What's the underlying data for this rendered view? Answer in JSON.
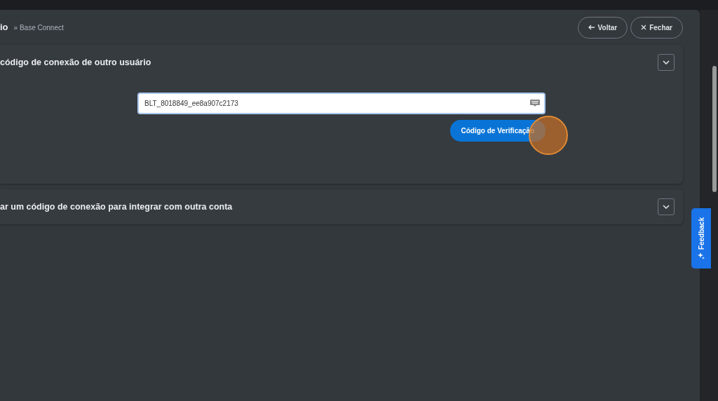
{
  "header": {
    "title": "io",
    "breadcrumb": "» Base Connect",
    "buttons": [
      {
        "kind": "back",
        "label": "Voltar"
      },
      {
        "kind": "close",
        "label": "Fechar"
      }
    ]
  },
  "sections": [
    {
      "title": "código de conexão de outro usuário",
      "expanded": true,
      "input": {
        "value": "BLT_8018849_ee8a907c2173"
      },
      "button": "Código de Verificação"
    },
    {
      "title": "ar um código de conexão para integrar com outra conta",
      "expanded": false
    }
  ],
  "feedback": {
    "label": "Feedback"
  }
}
